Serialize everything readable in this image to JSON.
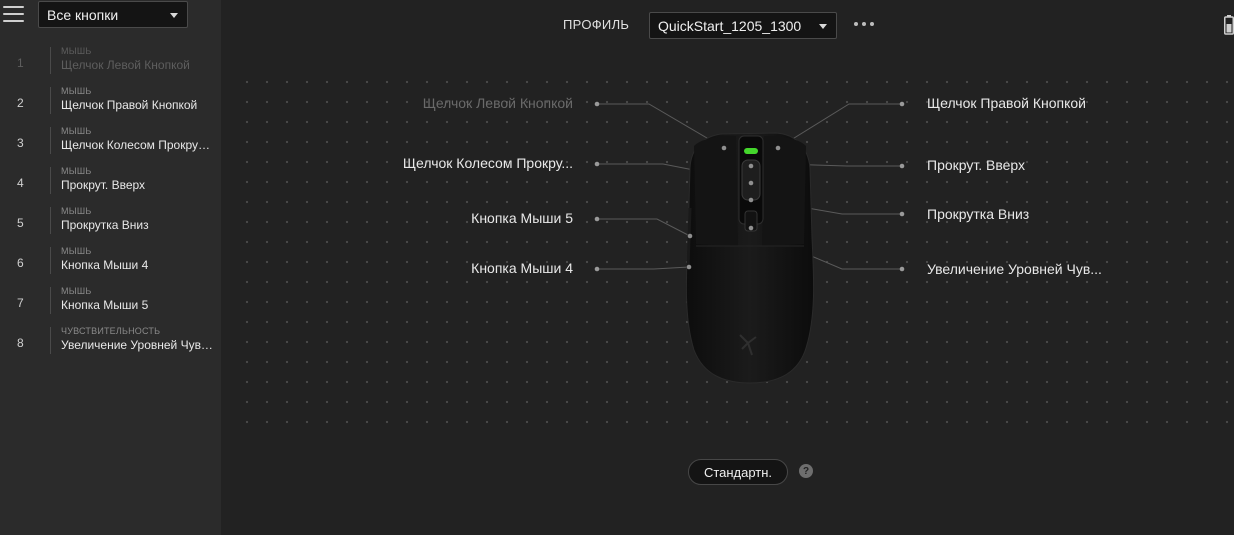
{
  "sidebar": {
    "filter_value": "Все кнопки",
    "items": [
      {
        "num": "1",
        "category": "МЫШЬ",
        "label": "Щелчок Левой Кнопкой"
      },
      {
        "num": "2",
        "category": "МЫШЬ",
        "label": "Щелчок Правой Кнопкой"
      },
      {
        "num": "3",
        "category": "МЫШЬ",
        "label": "Щелчок Колесом Прокрутки"
      },
      {
        "num": "4",
        "category": "МЫШЬ",
        "label": "Прокрут. Вверх"
      },
      {
        "num": "5",
        "category": "МЫШЬ",
        "label": "Прокрутка Вниз"
      },
      {
        "num": "6",
        "category": "МЫШЬ",
        "label": "Кнопка Мыши 4"
      },
      {
        "num": "7",
        "category": "МЫШЬ",
        "label": "Кнопка Мыши 5"
      },
      {
        "num": "8",
        "category": "ЧУВСТВИТЕЛЬНОСТЬ",
        "label": "Увеличение Уровней Чувствительности"
      }
    ]
  },
  "header": {
    "profile_label": "ПРОФИЛЬ",
    "profile_value": "QuickStart_1205_1300"
  },
  "callouts": {
    "left_click": "Щелчок Левой Кнопкой",
    "wheel_click": "Щелчок Колесом Прокру...",
    "mouse5": "Кнопка Мыши 5",
    "mouse4": "Кнопка Мыши 4",
    "right_click": "Щелчок Правой Кнопкой",
    "scroll_up": "Прокрут. Вверх",
    "scroll_down": "Прокрутка Вниз",
    "sens_up": "Увеличение Уровней Чув..."
  },
  "footer": {
    "mode_label": "Стандартн.",
    "help_glyph": "?"
  },
  "colors": {
    "accent_green": "#44d62c",
    "background": "#222222",
    "sidebar": "#2b2b2b"
  }
}
